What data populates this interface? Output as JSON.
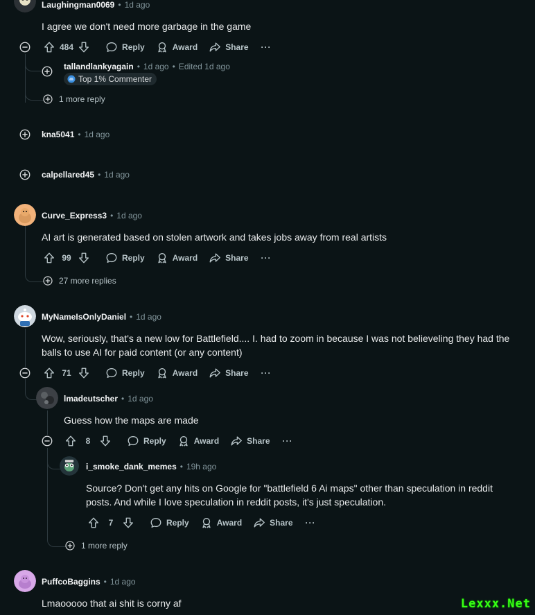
{
  "comments": {
    "c1": {
      "author": "Laughingman0069",
      "time": "1d ago",
      "body": "I agree we don't need more garbage in the game",
      "votes": "484",
      "reply": "Reply",
      "award": "Award",
      "share": "Share",
      "more": "···"
    },
    "c1r1": {
      "author": "tallandlankyagain",
      "time": "1d ago",
      "edited": "Edited 1d ago",
      "flair": "Top 1% Commenter"
    },
    "c1_more_replies": "1 more reply",
    "c2": {
      "author": "kna5041",
      "time": "1d ago"
    },
    "c3": {
      "author": "calpellared45",
      "time": "1d ago"
    },
    "c4": {
      "author": "Curve_Express3",
      "time": "1d ago",
      "body": "AI art is generated based on stolen artwork and takes jobs away from real artists",
      "votes": "99",
      "reply": "Reply",
      "award": "Award",
      "share": "Share",
      "more": "···"
    },
    "c4_more_replies": "27 more replies",
    "c5": {
      "author": "MyNameIsOnlyDaniel",
      "time": "1d ago",
      "body_line1": "Wow, seriously, that's a new low for Battlefield.... I. had to zoom in because I was not believeling they had the",
      "body_line2": "balls to use AI for paid content (or any content)",
      "votes": "71",
      "reply": "Reply",
      "award": "Award",
      "share": "Share",
      "more": "···"
    },
    "c5r1": {
      "author": "lmadeutscher",
      "time": "1d ago",
      "body": "Guess how the maps are made",
      "votes": "8",
      "reply": "Reply",
      "award": "Award",
      "share": "Share",
      "more": "···"
    },
    "c5r1r1": {
      "author": "i_smoke_dank_memes",
      "time": "19h ago",
      "body_line1": "Source? Don't get any hits on Google for \"battlefield 6 Ai maps\" other than speculation in reddit",
      "body_line2": "posts. And while I love speculation in reddit posts, it's just speculation.",
      "votes": "7",
      "reply": "Reply",
      "award": "Award",
      "share": "Share",
      "more": "···"
    },
    "c5r1_more_replies": "1 more reply",
    "c6": {
      "author": "PuffcoBaggins",
      "time": "1d ago",
      "body": "Lmaooooo that ai shit is corny af"
    }
  },
  "meta_separator": "•",
  "watermark": "Lexxx.Net",
  "colors": {
    "background": "#0b1416",
    "thread_line": "#2f3b40",
    "meta_text": "#82959b",
    "action_text": "#b8c5c9",
    "watermark": "#39ff14"
  },
  "icons": {
    "upvote": "upvote-arrow-icon",
    "downvote": "downvote-arrow-icon",
    "reply": "speech-bubble-icon",
    "award": "award-ribbon-icon",
    "share": "share-arrow-icon",
    "collapse": "minus-circle-icon",
    "expand": "plus-circle-icon"
  }
}
